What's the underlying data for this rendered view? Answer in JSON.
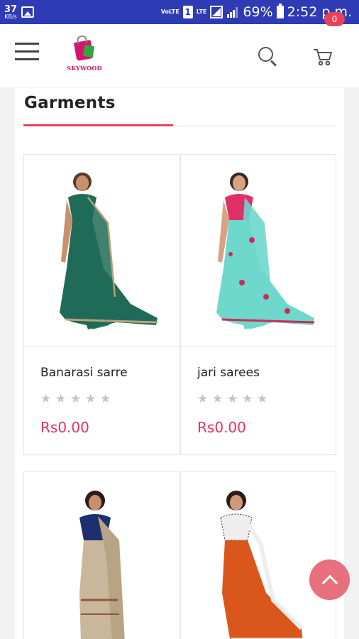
{
  "status_bar": {
    "speed_value": "37",
    "speed_unit": "KB/s",
    "volte_label": "VoLTE",
    "sim_slot": "1",
    "lte_label": "LTE",
    "battery": "69%",
    "time": "2:52 p.m."
  },
  "header": {
    "brand": "SKYWOOD",
    "cart_count": "0"
  },
  "section": {
    "title": "Garments"
  },
  "products": [
    {
      "name": "Banarasi sarre",
      "price": "Rs0.00",
      "rating": 0,
      "saree_color": "#1f6b57",
      "blouse_color": "#1f6b57"
    },
    {
      "name": "jari sarees",
      "price": "Rs0.00",
      "rating": 0,
      "saree_color": "#6ed8cc",
      "blouse_color": "#e0306a"
    },
    {
      "name": "",
      "price": "",
      "rating": 0,
      "saree_color": "#c9b79b",
      "blouse_color": "#1e2f70"
    },
    {
      "name": "",
      "price": "",
      "rating": 0,
      "saree_color": "#d9571c",
      "blouse_color": "#eeeeee"
    }
  ],
  "colors": {
    "status_bar": "#2e3bb5",
    "accent": "#e8425a",
    "price": "#e8325a",
    "scroll_top": "#e8707c"
  },
  "icons": [
    "menu-icon",
    "search-icon",
    "cart-icon",
    "chevron-up-icon",
    "star-icon"
  ]
}
